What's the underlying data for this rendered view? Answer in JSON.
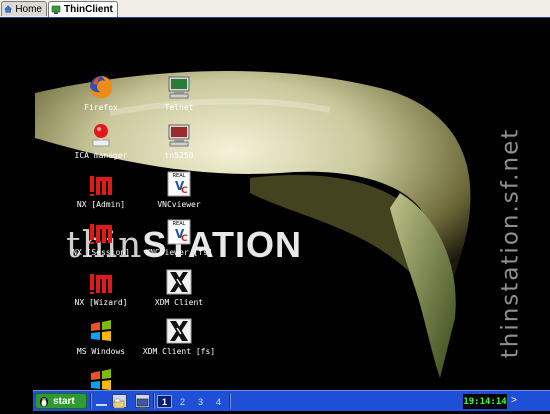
{
  "tabs": [
    {
      "label": "Home",
      "icon": "house-icon"
    },
    {
      "label": "ThinClient",
      "icon": "thinclient-icon"
    }
  ],
  "wallpaper": {
    "vertical_text": "thinstation.sf.net",
    "logo_thin": "thin",
    "logo_station": "STATION"
  },
  "desktop_icons": [
    {
      "label": "Firefox",
      "icon": "firefox-icon"
    },
    {
      "label": "Telnet",
      "icon": "terminal-icon"
    },
    {
      "label": "ICA manager",
      "icon": "ica-icon"
    },
    {
      "label": "tn5250",
      "icon": "terminal-red-icon"
    },
    {
      "label": "NX [Admin]",
      "icon": "nx-icon"
    },
    {
      "label": "VNCviewer",
      "icon": "vnc-icon"
    },
    {
      "label": "NX [Session]",
      "icon": "nx-icon"
    },
    {
      "label": "VNCviewer [fs]",
      "icon": "vnc-icon"
    },
    {
      "label": "NX [Wizard]",
      "icon": "nx-icon"
    },
    {
      "label": "XDM Client",
      "icon": "x-icon"
    },
    {
      "label": "MS Windows",
      "icon": "windows-icon"
    },
    {
      "label": "XDM Client [fs]",
      "icon": "x-icon"
    }
  ],
  "taskbar": {
    "start_label": "start",
    "workspaces": [
      "1",
      "2",
      "3",
      "4"
    ],
    "active_workspace": "1",
    "clock": "19:14:14",
    "more_arrow": ">"
  },
  "colors": {
    "taskbar": "#1e4fd6",
    "start": "#2f9a2f",
    "clock_text": "#3cff3c"
  }
}
